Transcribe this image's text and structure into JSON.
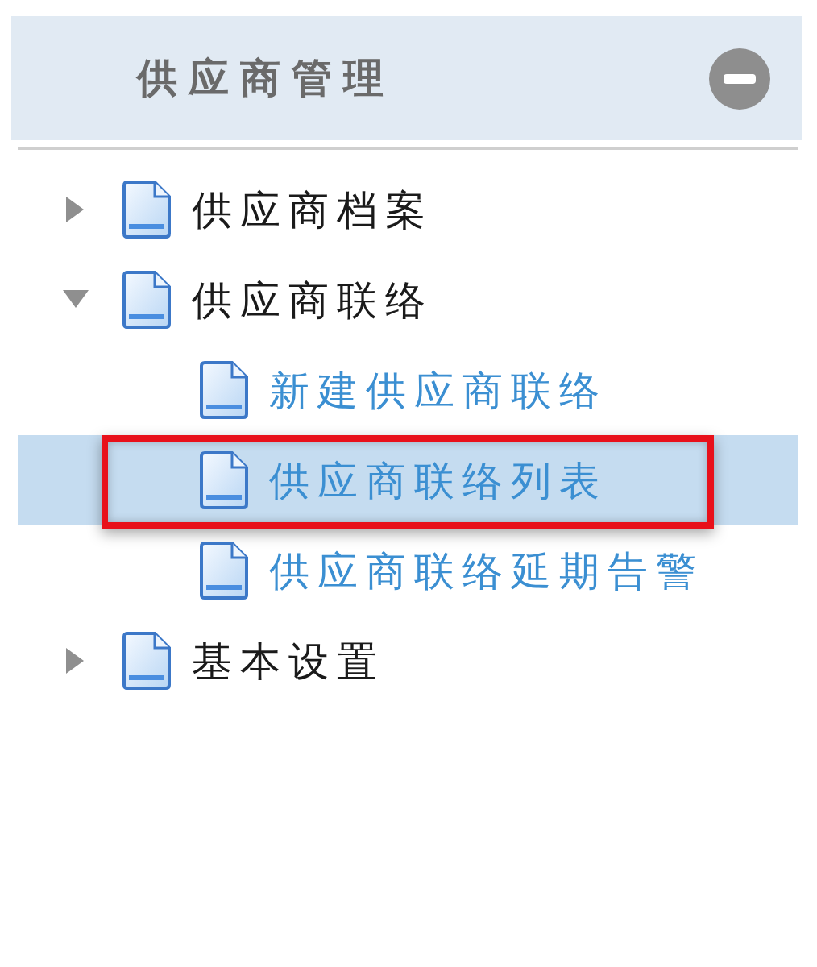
{
  "panel": {
    "title": "供应商管理",
    "collapsed": false
  },
  "tree": [
    {
      "label": "供应商档案",
      "expanded": false,
      "selected": false
    },
    {
      "label": "供应商联络",
      "expanded": true,
      "selected": false,
      "children": [
        {
          "label": "新建供应商联络",
          "selected": false
        },
        {
          "label": "供应商联络列表",
          "selected": true,
          "highlighted": true
        },
        {
          "label": "供应商联络延期告警",
          "selected": false
        }
      ]
    },
    {
      "label": "基本设置",
      "expanded": false,
      "selected": false
    }
  ]
}
